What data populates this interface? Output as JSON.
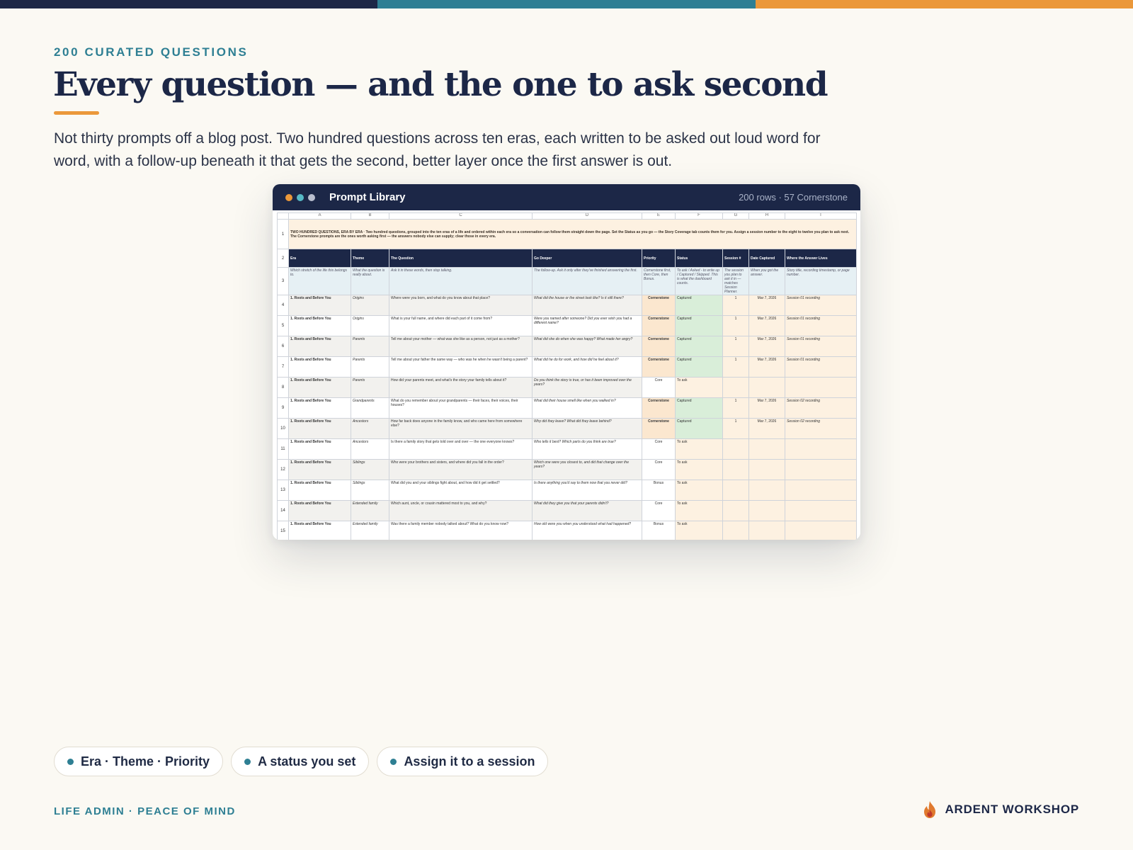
{
  "colors": {
    "navy": "#1c2747",
    "teal": "#2e7f93",
    "orange": "#eb983a",
    "cream": "#fbf9f3",
    "captured_green": "#d9eed9",
    "to_ask_peach": "#fdf1e1",
    "header_blue": "#e6f0f4"
  },
  "eyebrow": "200 CURATED QUESTIONS",
  "headline": "Every question — and the one to ask second",
  "subtitle": "Not thirty prompts off a blog post. Two hundred questions across ten eras, each written to be asked out loud word for word, with a follow-up beneath it that gets the second, better layer once the first answer is out.",
  "window": {
    "title": "Prompt Library",
    "meta": "200 rows · 57 Cornerstone",
    "traffic_light_colors": [
      "#eb983a",
      "#56b9c6",
      "#b9bfcf"
    ]
  },
  "sheet": {
    "column_letters": [
      "A",
      "B",
      "C",
      "D",
      "E",
      "F",
      "G",
      "H",
      "I"
    ],
    "intro_text": "TWO HUNDRED QUESTIONS, ERA BY ERA · Two hundred questions, grouped into the ten eras of a life and ordered within each era so a conversation can follow them straight down the page. Set the Status as you go — the Story Coverage tab counts them for you. Assign a session number to the eight to twelve you plan to ask next. The Cornerstone prompts are the ones worth asking first — the answers nobody else can supply; clear those in every era.",
    "headers": [
      "Era",
      "Theme",
      "The Question",
      "Go Deeper",
      "Priority",
      "Status",
      "Session #",
      "Date Captured",
      "Where the Answer Lives"
    ],
    "descriptions": [
      "Which stretch of the life this belongs to.",
      "What the question is really about.",
      "Ask it in these words, then stop talking.",
      "The follow-up. Ask it only after they've finished answering the first.",
      "Cornerstone first, then Core, then Bonus.",
      "To ask / Asked - to write up / Captured / Skipped. This is what the dashboard counts.",
      "The session you plan to ask it in — matches Session Planner.",
      "When you got the answer.",
      "Story title, recording timestamp, or page number."
    ],
    "rows": [
      {
        "num": "4",
        "era": "1. Roots and Before You",
        "theme": "Origins",
        "question": "Where were you born, and what do you know about that place?",
        "deeper": "What did the house or the street look like? Is it still there?",
        "priority": "Cornerstone",
        "status": "Captured",
        "session": "1",
        "date": "Mar 7, 2026",
        "where": "Session 01 recording"
      },
      {
        "num": "5",
        "era": "1. Roots and Before You",
        "theme": "Origins",
        "question": "What is your full name, and where did each part of it come from?",
        "deeper": "Were you named after someone? Did you ever wish you had a different name?",
        "priority": "Cornerstone",
        "status": "Captured",
        "session": "1",
        "date": "Mar 7, 2026",
        "where": "Session 01 recording"
      },
      {
        "num": "6",
        "era": "1. Roots and Before You",
        "theme": "Parents",
        "question": "Tell me about your mother — what was she like as a person, not just as a mother?",
        "deeper": "What did she do when she was happy? What made her angry?",
        "priority": "Cornerstone",
        "status": "Captured",
        "session": "1",
        "date": "Mar 7, 2026",
        "where": "Session 01 recording"
      },
      {
        "num": "7",
        "era": "1. Roots and Before You",
        "theme": "Parents",
        "question": "Tell me about your father the same way — who was he when he wasn't being a parent?",
        "deeper": "What did he do for work, and how did he feel about it?",
        "priority": "Cornerstone",
        "status": "Captured",
        "session": "1",
        "date": "Mar 7, 2026",
        "where": "Session 01 recording"
      },
      {
        "num": "8",
        "era": "1. Roots and Before You",
        "theme": "Parents",
        "question": "How did your parents meet, and what's the story your family tells about it?",
        "deeper": "Do you think the story is true, or has it been improved over the years?",
        "priority": "Core",
        "status": "To ask",
        "session": "",
        "date": "",
        "where": ""
      },
      {
        "num": "9",
        "era": "1. Roots and Before You",
        "theme": "Grandparents",
        "question": "What do you remember about your grandparents — their faces, their voices, their houses?",
        "deeper": "What did their house smell like when you walked in?",
        "priority": "Cornerstone",
        "status": "Captured",
        "session": "1",
        "date": "Mar 7, 2026",
        "where": "Session 02 recording"
      },
      {
        "num": "10",
        "era": "1. Roots and Before You",
        "theme": "Ancestors",
        "question": "How far back does anyone in the family know, and who came here from somewhere else?",
        "deeper": "Why did they leave? What did they leave behind?",
        "priority": "Cornerstone",
        "status": "Captured",
        "session": "1",
        "date": "Mar 7, 2026",
        "where": "Session 02 recording"
      },
      {
        "num": "11",
        "era": "1. Roots and Before You",
        "theme": "Ancestors",
        "question": "Is there a family story that gets told over and over — the one everyone knows?",
        "deeper": "Who tells it best? Which parts do you think are true?",
        "priority": "Core",
        "status": "To ask",
        "session": "",
        "date": "",
        "where": ""
      },
      {
        "num": "12",
        "era": "1. Roots and Before You",
        "theme": "Siblings",
        "question": "Who were your brothers and sisters, and where did you fall in the order?",
        "deeper": "Which one were you closest to, and did that change over the years?",
        "priority": "Core",
        "status": "To ask",
        "session": "",
        "date": "",
        "where": ""
      },
      {
        "num": "13",
        "era": "1. Roots and Before You",
        "theme": "Siblings",
        "question": "What did you and your siblings fight about, and how did it get settled?",
        "deeper": "Is there anything you'd say to them now that you never did?",
        "priority": "Bonus",
        "status": "To ask",
        "session": "",
        "date": "",
        "where": ""
      },
      {
        "num": "14",
        "era": "1. Roots and Before You",
        "theme": "Extended family",
        "question": "Which aunt, uncle, or cousin mattered most to you, and why?",
        "deeper": "What did they give you that your parents didn't?",
        "priority": "Core",
        "status": "To ask",
        "session": "",
        "date": "",
        "where": ""
      },
      {
        "num": "15",
        "era": "1. Roots and Before You",
        "theme": "Extended family",
        "question": "Was there a family member nobody talked about? What do you know now?",
        "deeper": "How old were you when you understood what had happened?",
        "priority": "Bonus",
        "status": "To ask",
        "session": "",
        "date": "",
        "where": ""
      }
    ]
  },
  "pills": [
    {
      "label": "Era · Theme · Priority"
    },
    {
      "label": "A status you set"
    },
    {
      "label": "Assign it to a session"
    }
  ],
  "footer_left": "LIFE ADMIN · PEACE OF MIND",
  "brand": "ARDENT WORKSHOP"
}
